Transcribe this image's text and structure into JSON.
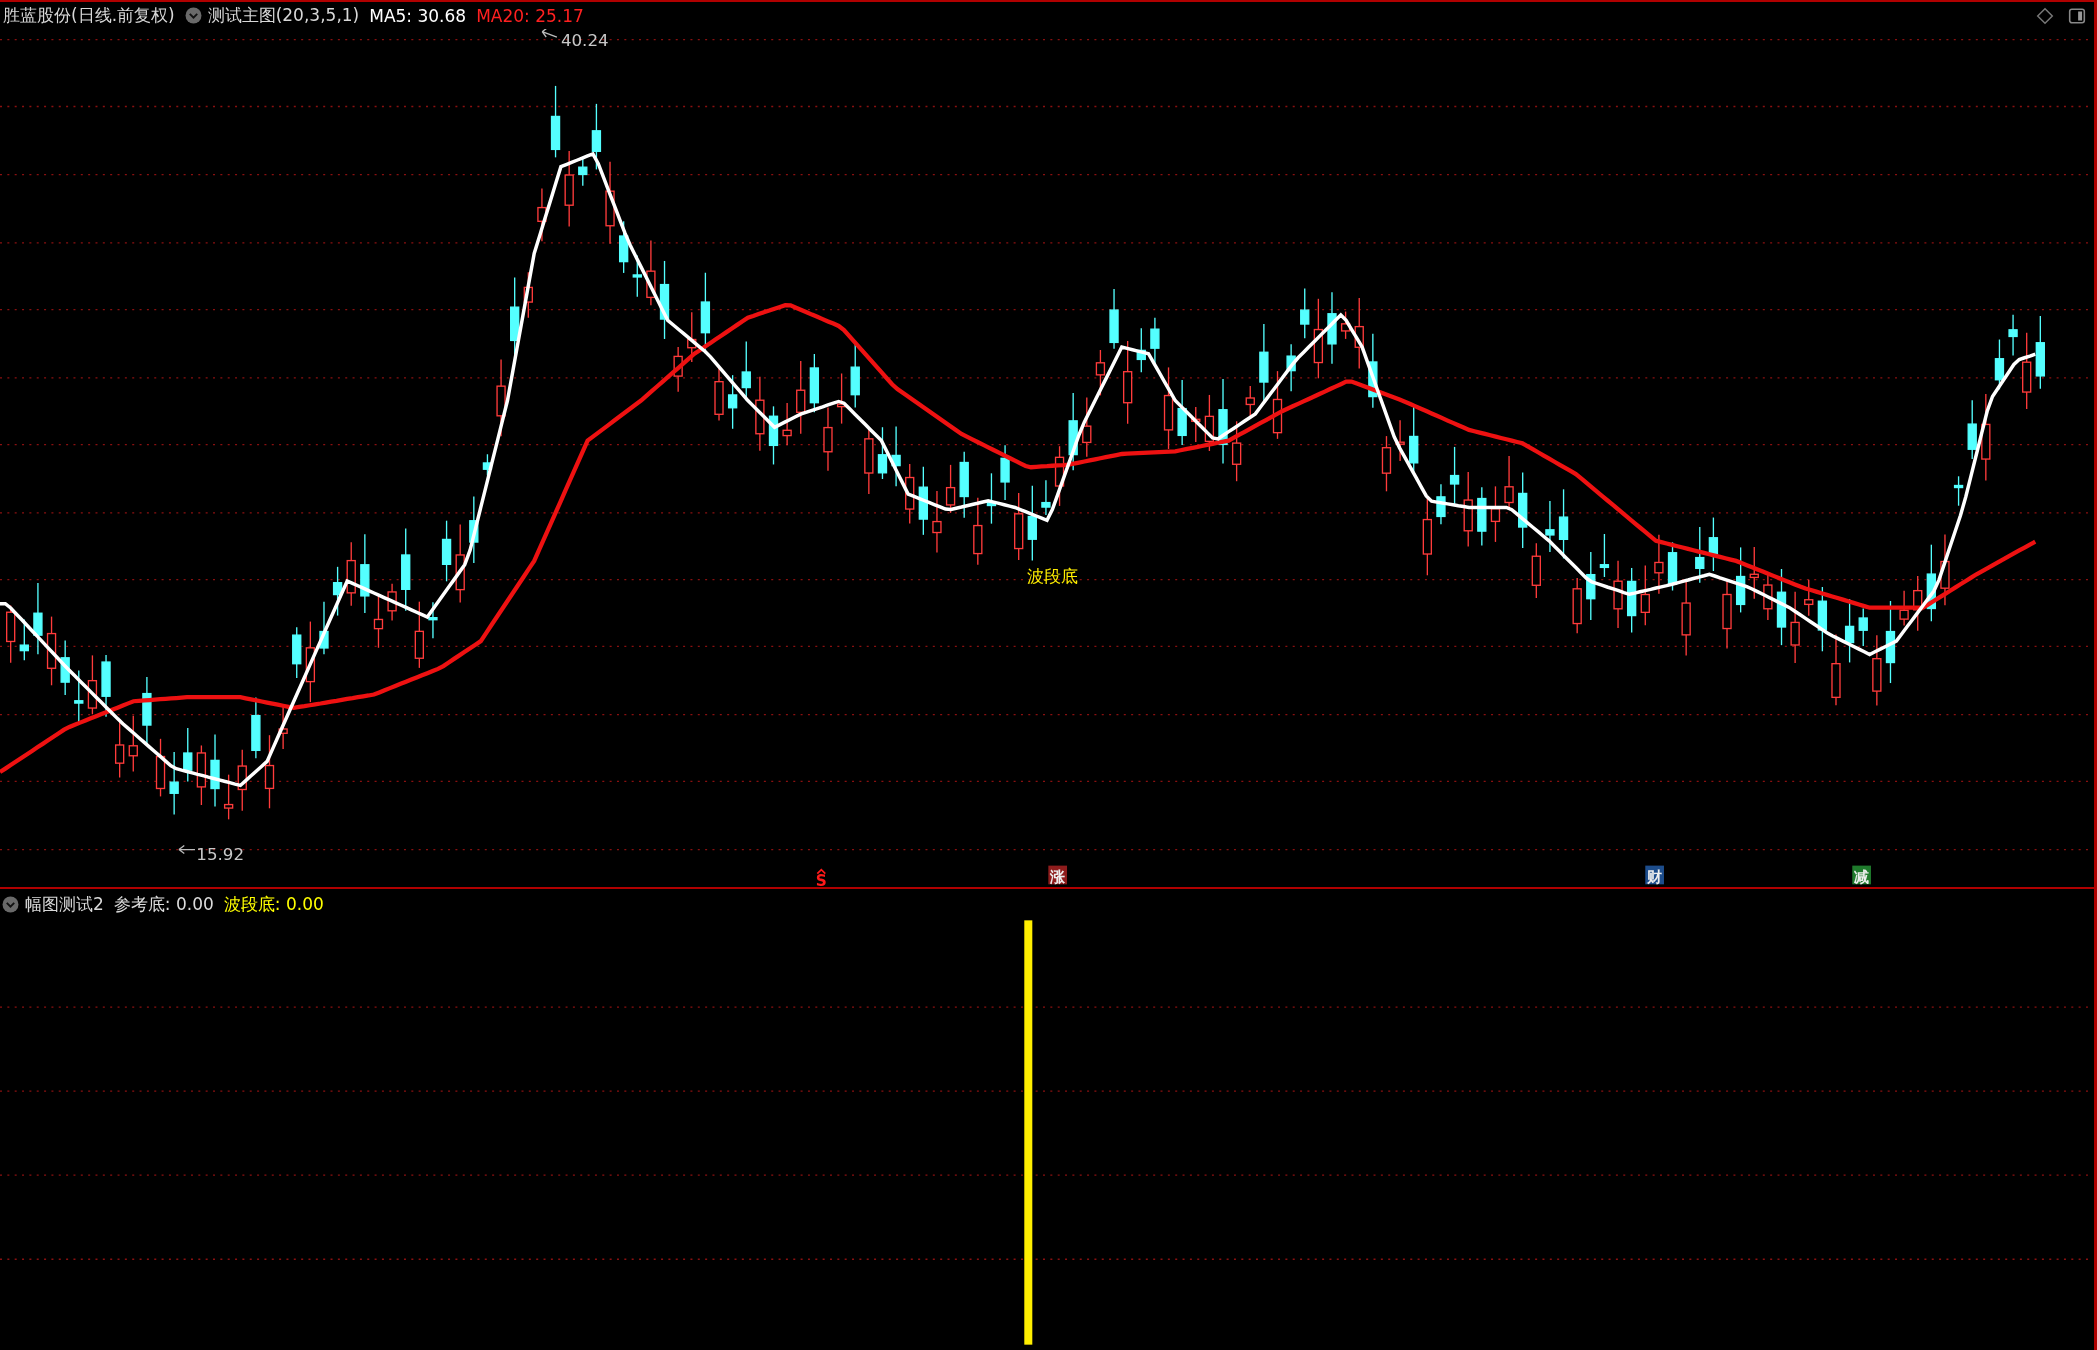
{
  "header": {
    "title": "胜蓝股份(日线.前复权)",
    "indicator": "测试主图(20,3,5,1)",
    "legend": [
      {
        "label": "MA5: 30.68",
        "color": "#ffffff"
      },
      {
        "label": "MA20: 25.17",
        "color": "#ff2020"
      }
    ]
  },
  "main_chart": {
    "high_label": "40.24",
    "low_label": "15.92",
    "signal_label": "波段底",
    "markers": [
      {
        "text": "S",
        "kind": "plain",
        "color": "#ff1a1a"
      },
      {
        "text": "涨",
        "kind": "badge",
        "color": "#8e1c1c"
      },
      {
        "text": "财",
        "kind": "badge",
        "color": "#1d4d8c"
      },
      {
        "text": "减",
        "kind": "badge",
        "color": "#1f7a2c"
      }
    ]
  },
  "sub_panel": {
    "title": "幅图测试2",
    "legend": [
      {
        "label": "参考底: 0.00",
        "color": "#dcdcdc"
      },
      {
        "label": "波段底: 0.00",
        "color": "#ffff00"
      }
    ]
  }
}
